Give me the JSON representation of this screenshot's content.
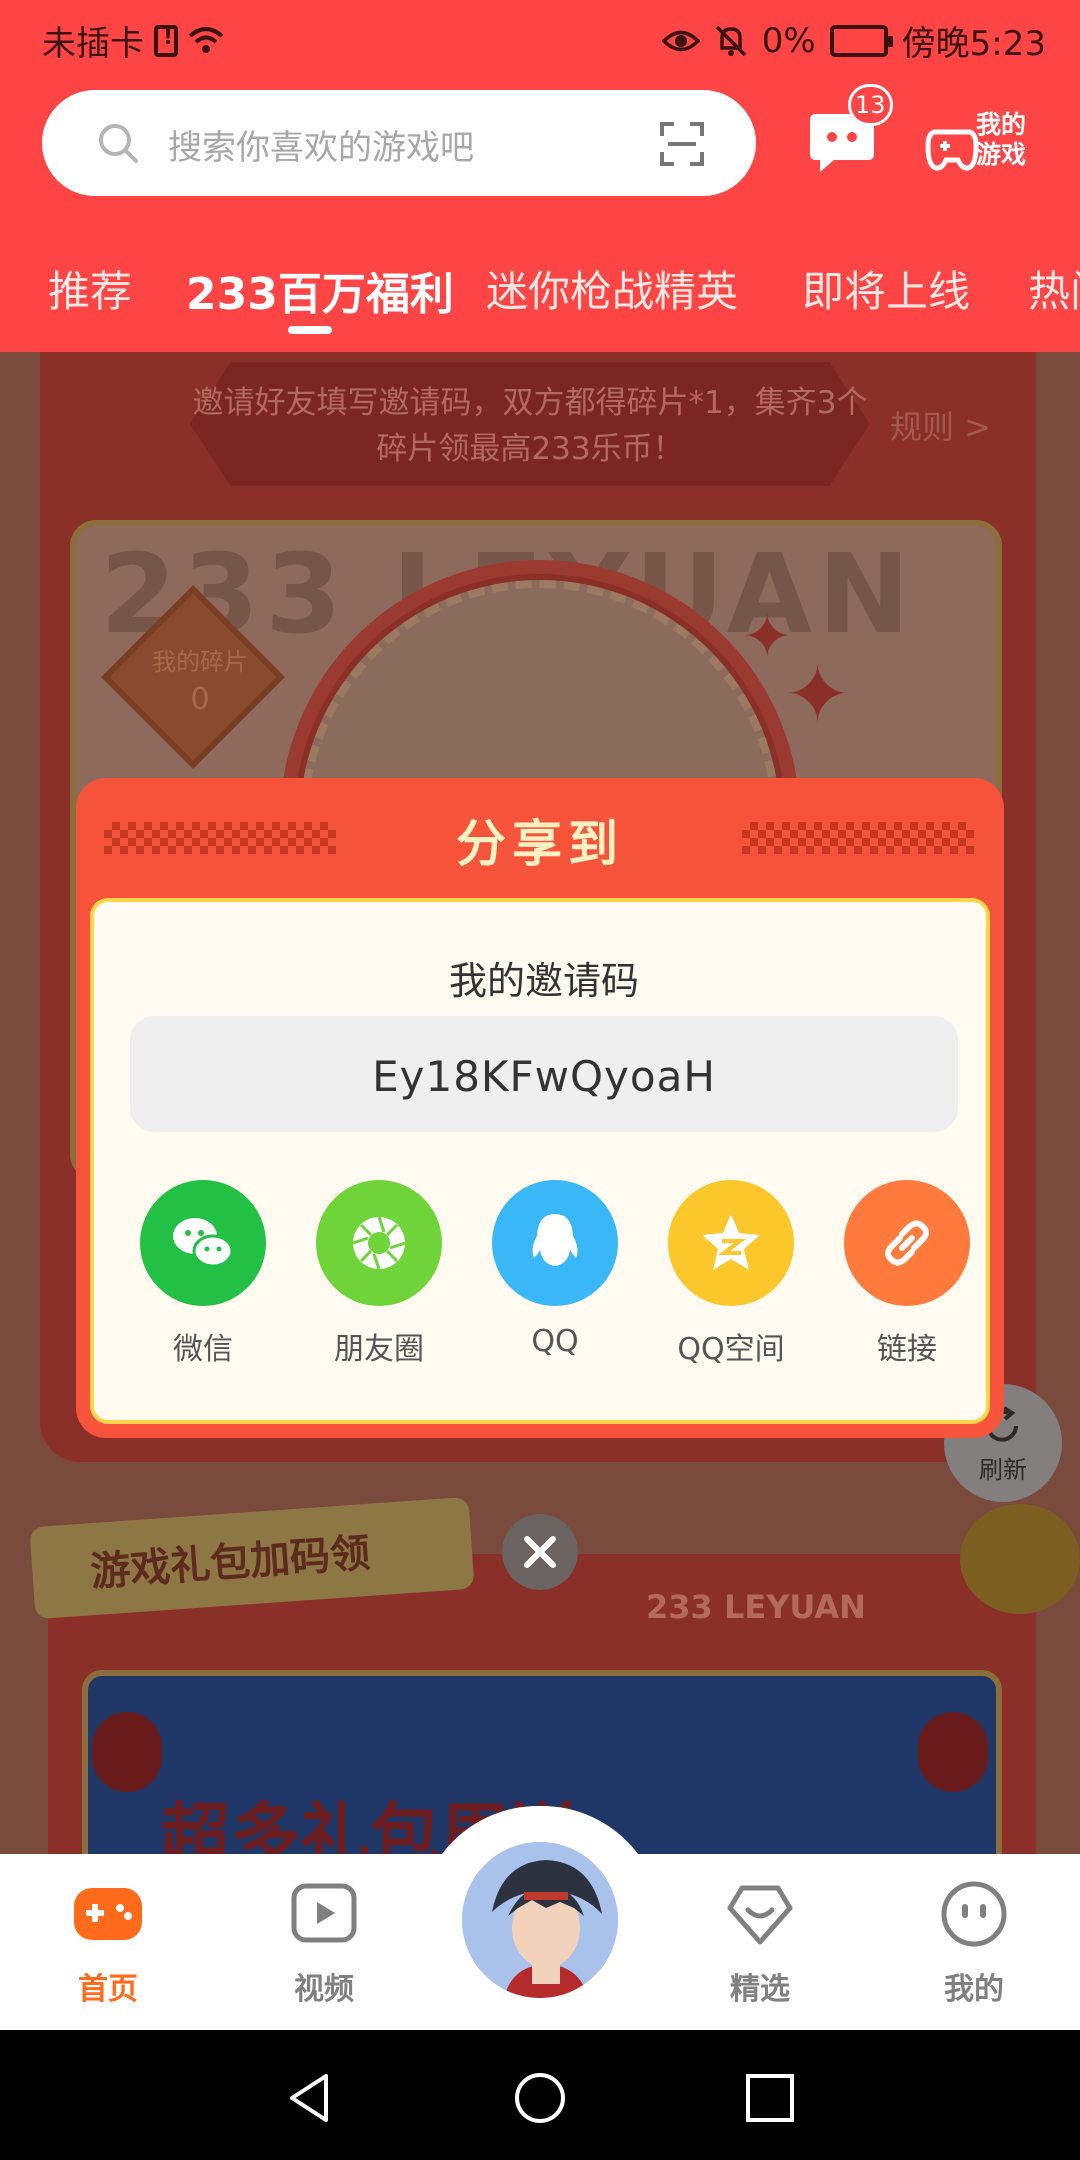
{
  "status_bar": {
    "carrier": "未插卡",
    "battery": "0%",
    "time": "傍晚5:23"
  },
  "search": {
    "placeholder": "搜索你喜欢的游戏吧"
  },
  "header": {
    "message_badge": "13",
    "my_games_label": "我的游戏"
  },
  "tabs": [
    {
      "label": "推荐"
    },
    {
      "label": "233百万福利"
    },
    {
      "label": "迷你枪战精英"
    },
    {
      "label": "即将上线"
    },
    {
      "label": "热门"
    }
  ],
  "background": {
    "invite_banner": "邀请好友填写邀请码，双方都得碎片*1，集齐3个碎片领最高233乐币！",
    "rules_link": "规则 >",
    "watermark": "233 LEYUAN",
    "my_fragments_label": "我的碎片",
    "my_fragments_value": "0",
    "refresh_label": "刷新",
    "gift_section_title": "游戏礼包加码领",
    "leyuan_label": "233 LEYUAN",
    "gift_banner_text": "超多礼包周送"
  },
  "modal": {
    "title": "分享到",
    "invite_label": "我的邀请码",
    "invite_code": "Ey18KFwQyoaH",
    "share_targets": [
      {
        "label": "微信",
        "icon": "wechat-icon",
        "color": "#22c146"
      },
      {
        "label": "朋友圈",
        "icon": "moments-icon",
        "color": "#6fd33a"
      },
      {
        "label": "QQ",
        "icon": "qq-icon",
        "color": "#3ab7f7"
      },
      {
        "label": "QQ空间",
        "icon": "qzone-icon",
        "color": "#fcc72b"
      },
      {
        "label": "链接",
        "icon": "link-icon",
        "color": "#ff7a3d"
      }
    ]
  },
  "bottom_nav": [
    {
      "label": "首页",
      "active": true
    },
    {
      "label": "视频",
      "active": false
    },
    {
      "label": "精选",
      "active": false
    },
    {
      "label": "我的",
      "active": false
    }
  ],
  "colors": {
    "header_red": "#fe4545",
    "modal_orange": "#f6533b",
    "active_orange": "#ff6b1a"
  }
}
